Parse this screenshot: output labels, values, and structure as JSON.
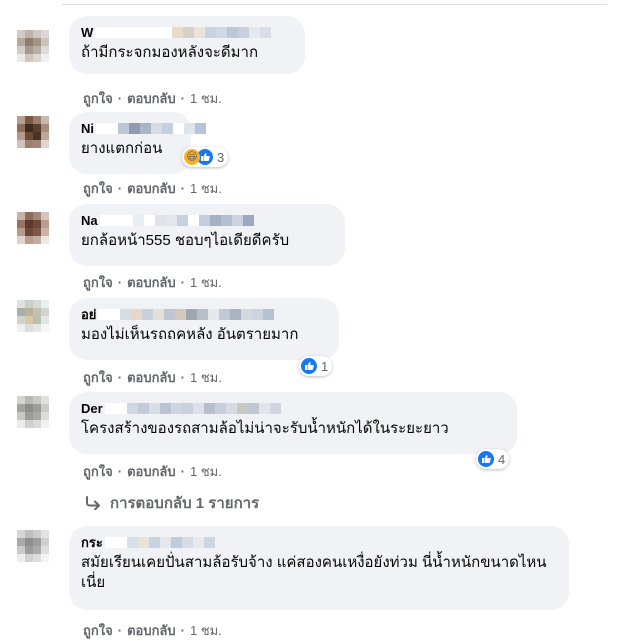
{
  "actions": {
    "like": "ถูกใจ",
    "reply": "ตอบกลับ",
    "separator": "·"
  },
  "colors": {
    "like_blue": "#1877f2",
    "haha_yellow": "#f7b125",
    "bubble": "#f0f2f5",
    "meta_text": "#65676b"
  },
  "comments": [
    {
      "name": "W",
      "text": "ถ้ามีกระจกมองหลังจะดีมาก",
      "time": "1 ชม.",
      "avatar": [
        "#d3cbc6",
        "#bfb3ab",
        "#cfc6c0",
        "#ddd6d2",
        "#b7a89c",
        "#8f7c6f",
        "#a49486",
        "#cbc2bb",
        "#d4ccc6",
        "#a59a91",
        "#b9aea5",
        "#e0dbd7",
        "#ece9e6",
        "#cfc6bf",
        "#ddd6d1",
        "#f2efec"
      ],
      "mosaic": [
        "#ffffff",
        "#ffffff",
        "#ffffff",
        "#ffffff",
        "#ffffff",
        "#ffffff",
        "#ffffff",
        "#e8dcc8",
        "#d8d0c5",
        "#e9e4da",
        "#c8d4e0",
        "#d0d8e4",
        "#bcc8d6",
        "#c9d0dc",
        "#e5e9ef",
        "#d8dde6"
      ]
    },
    {
      "name": "Ni",
      "text": "ยางแตกก่อน",
      "time": "1 ชม.",
      "reactions": {
        "count": "3",
        "types": [
          "haha-icon",
          "like-icon"
        ]
      },
      "avatar": [
        "#b89e8f",
        "#7a5a47",
        "#9b7e6c",
        "#c8b9ae",
        "#8d6d59",
        "#3f2a1f",
        "#5a3e2e",
        "#a58c7c",
        "#b4998a",
        "#6b4c39",
        "#4a3325",
        "#bca99d",
        "#d0c3bb",
        "#9a8172",
        "#a18676",
        "#e0d6cf"
      ],
      "mosaic": [
        "#ffffff",
        "#ffffff",
        "#bcc6d4",
        "#8e9bb0",
        "#a8b5c7",
        "#d6dce6",
        "#c4cfe0",
        "#ffffff",
        "#dfe3ea",
        "#b6c4d8"
      ]
    },
    {
      "name": "Na",
      "text": "ยกล้อหน้า555 ชอบๆไอเดียดีครับ",
      "time": "1 ชม.",
      "avatar": [
        "#c8b3a8",
        "#8d6c5d",
        "#a4867a",
        "#d4c4bc",
        "#9a7264",
        "#5e3a2c",
        "#6e4a3b",
        "#b99c8f",
        "#b79b8e",
        "#6a4738",
        "#7b5848",
        "#c9b2a6",
        "#e0d3cc",
        "#b59d92",
        "#c3aca1",
        "#efe7e2"
      ],
      "mosaic": [
        "#ffffff",
        "#ffffff",
        "#ffffff",
        "#eaeef4",
        "#ffffff",
        "#dfe3ea",
        "#e4e8ee",
        "#c6d0de",
        "#ffffff",
        "#c4cde0",
        "#a4b1c9",
        "#b3bed2",
        "#cbd3e1",
        "#9aa8c2"
      ]
    },
    {
      "name": "อย่",
      "text": "มองไม่เห็นรถถคหลัง อันตรายมาก",
      "time": "1 ชม.",
      "reactions": {
        "count": "1",
        "types": [
          "like-icon"
        ]
      },
      "avatar": [
        "#dfe2e0",
        "#c9cfc9",
        "#d6dad6",
        "#eceeec",
        "#a7b0a6",
        "#b9b0a0",
        "#c4c0b2",
        "#d0d4cf",
        "#cfd3cd",
        "#d9c7a6",
        "#b8c0b4",
        "#e2e5e1",
        "#eef0ee",
        "#dcdfdb",
        "#e5e7e4",
        "#f4f5f4"
      ],
      "mosaic": [
        "#ffffff",
        "#ffffff",
        "#d8dde5",
        "#e6d7c8",
        "#c7d1de",
        "#e3e0da",
        "#bfc6d1",
        "#d4c9be",
        "#9fa7b3",
        "#b9bfc9",
        "#e4e7ec",
        "#c2c9d4",
        "#a9b3c2",
        "#d5d9df",
        "#ced4dd",
        "#b8c1cf"
      ]
    },
    {
      "name": "Der",
      "text": "โครงสร้างของรถสามล้อไม่น่าจะรับน้ำหนักได้ในระยะยาว",
      "time": "1 ชม.",
      "reactions": {
        "count": "4",
        "types": [
          "like-icon"
        ]
      },
      "avatar": [
        "#d3d3d1",
        "#b8b8b5",
        "#c9c9c6",
        "#e0e0de",
        "#a3a3a0",
        "#8d8d8a",
        "#9d9d9a",
        "#cacac7",
        "#c7c7c4",
        "#9b9b98",
        "#a8a8a5",
        "#dcdcda",
        "#ebebea",
        "#cfcfcd",
        "#dadad8",
        "#f1f1f0"
      ],
      "mosaic": [
        "#ffffff",
        "#ffffff",
        "#d1d7e1",
        "#c2cbd8",
        "#d9dde4",
        "#b8c4d4",
        "#ced5e0",
        "#c9d1dd",
        "#dde1e7",
        "#b5bfcd",
        "#c8cfd9",
        "#d6dbe2",
        "#cbc8c4",
        "#bfc7d3",
        "#e1e4ea",
        "#d0d6df"
      ]
    },
    {
      "name": "กระ",
      "text": "สมัยเรียนเคยปั่นสามล้อรับจ้าง แค่สองคนเหงื่อยังท่วม นี่น้ำหนักขนาดไหน เนี่ย",
      "time": "1 ชม.",
      "avatar": [
        "#d7d7d7",
        "#bfbfbf",
        "#cdcdcd",
        "#e4e4e4",
        "#a9a9a9",
        "#8f8f8f",
        "#9e9e9e",
        "#cfcfcf",
        "#cbcbcb",
        "#9c9c9c",
        "#ababab",
        "#dedede",
        "#ededed",
        "#d2d2d2",
        "#dcdcdc",
        "#f3f3f3"
      ],
      "mosaic": [
        "#ffffff",
        "#ffffff",
        "#d9dfe8",
        "#e8e2d8",
        "#c8d3e2",
        "#e4e8ee",
        "#bfccdc",
        "#d6dce6",
        "#e7e9ed",
        "#cdd5e1"
      ]
    }
  ],
  "replies": {
    "label": "การตอบกลับ 1 รายการ"
  }
}
